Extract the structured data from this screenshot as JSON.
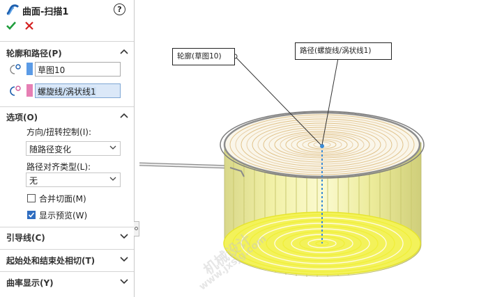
{
  "panel": {
    "title": "曲面-扫描1",
    "section_profile_path": {
      "label": "轮廓和路径(P)",
      "profile_value": "草图10",
      "path_value": "螺旋线/涡状线1",
      "profile_color": "#5b9be6",
      "path_color": "#e67fb4"
    },
    "section_options": {
      "label": "选项(O)",
      "orient_label": "方向/扭转控制(I):",
      "orient_value": "随路径变化",
      "align_label": "路径对齐类型(L):",
      "align_value": "无",
      "merge_label": "合并切面(M)",
      "merge_checked": false,
      "preview_label": "显示预览(W)",
      "preview_checked": true
    },
    "section_guides": {
      "label": "引导线(C)"
    },
    "section_tangency": {
      "label": "起始处和结束处相切(T)"
    },
    "section_curvature": {
      "label": "曲率显示(Y)"
    }
  },
  "viewport": {
    "callout_profile": "轮廓(草图10)",
    "callout_path": "路径(螺旋线/涡状线1)",
    "watermark_cn": "机械设计",
    "watermark_url": "www.jxsjg.com"
  },
  "colors": {
    "ok": "#1f9d3c",
    "cancel": "#d42020",
    "preview_yellow": "#f0ef3c",
    "path_dashed": "#3a8bd6"
  },
  "icons": [
    "sweep-surface-icon",
    "help-icon",
    "ok-check-icon",
    "cancel-x-icon",
    "profile-icon",
    "path-icon",
    "chevron-up-icon",
    "chevron-down-icon",
    "dropdown-arrow-icon"
  ]
}
